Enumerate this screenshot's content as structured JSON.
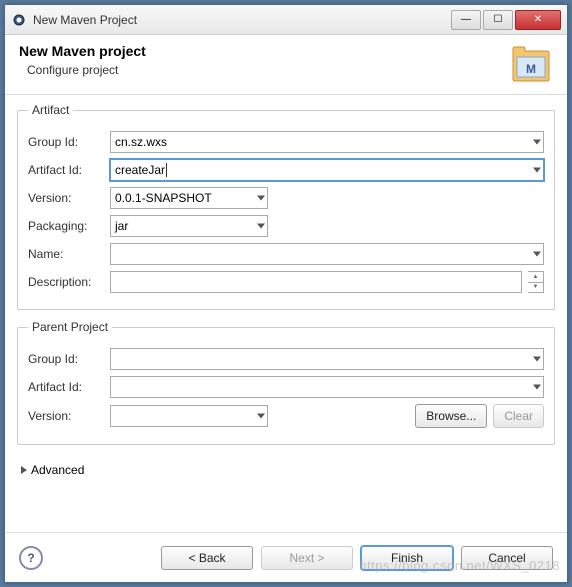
{
  "window": {
    "title": "New Maven Project"
  },
  "header": {
    "title": "New Maven project",
    "subtitle": "Configure project"
  },
  "artifact": {
    "legend": "Artifact",
    "groupIdLabel": "Group Id:",
    "groupId": "cn.sz.wxs",
    "artifactIdLabel": "Artifact Id:",
    "artifactId": "createJar",
    "versionLabel": "Version:",
    "version": "0.0.1-SNAPSHOT",
    "packagingLabel": "Packaging:",
    "packaging": "jar",
    "nameLabel": "Name:",
    "name": "",
    "descriptionLabel": "Description:",
    "description": ""
  },
  "parent": {
    "legend": "Parent Project",
    "groupIdLabel": "Group Id:",
    "groupId": "",
    "artifactIdLabel": "Artifact Id:",
    "artifactId": "",
    "versionLabel": "Version:",
    "version": "",
    "browseLabel": "Browse...",
    "clearLabel": "Clear"
  },
  "advancedLabel": "Advanced",
  "footer": {
    "back": "< Back",
    "next": "Next >",
    "finish": "Finish",
    "cancel": "Cancel"
  },
  "watermark": "https://blog.csdn.net/WXS_0218"
}
